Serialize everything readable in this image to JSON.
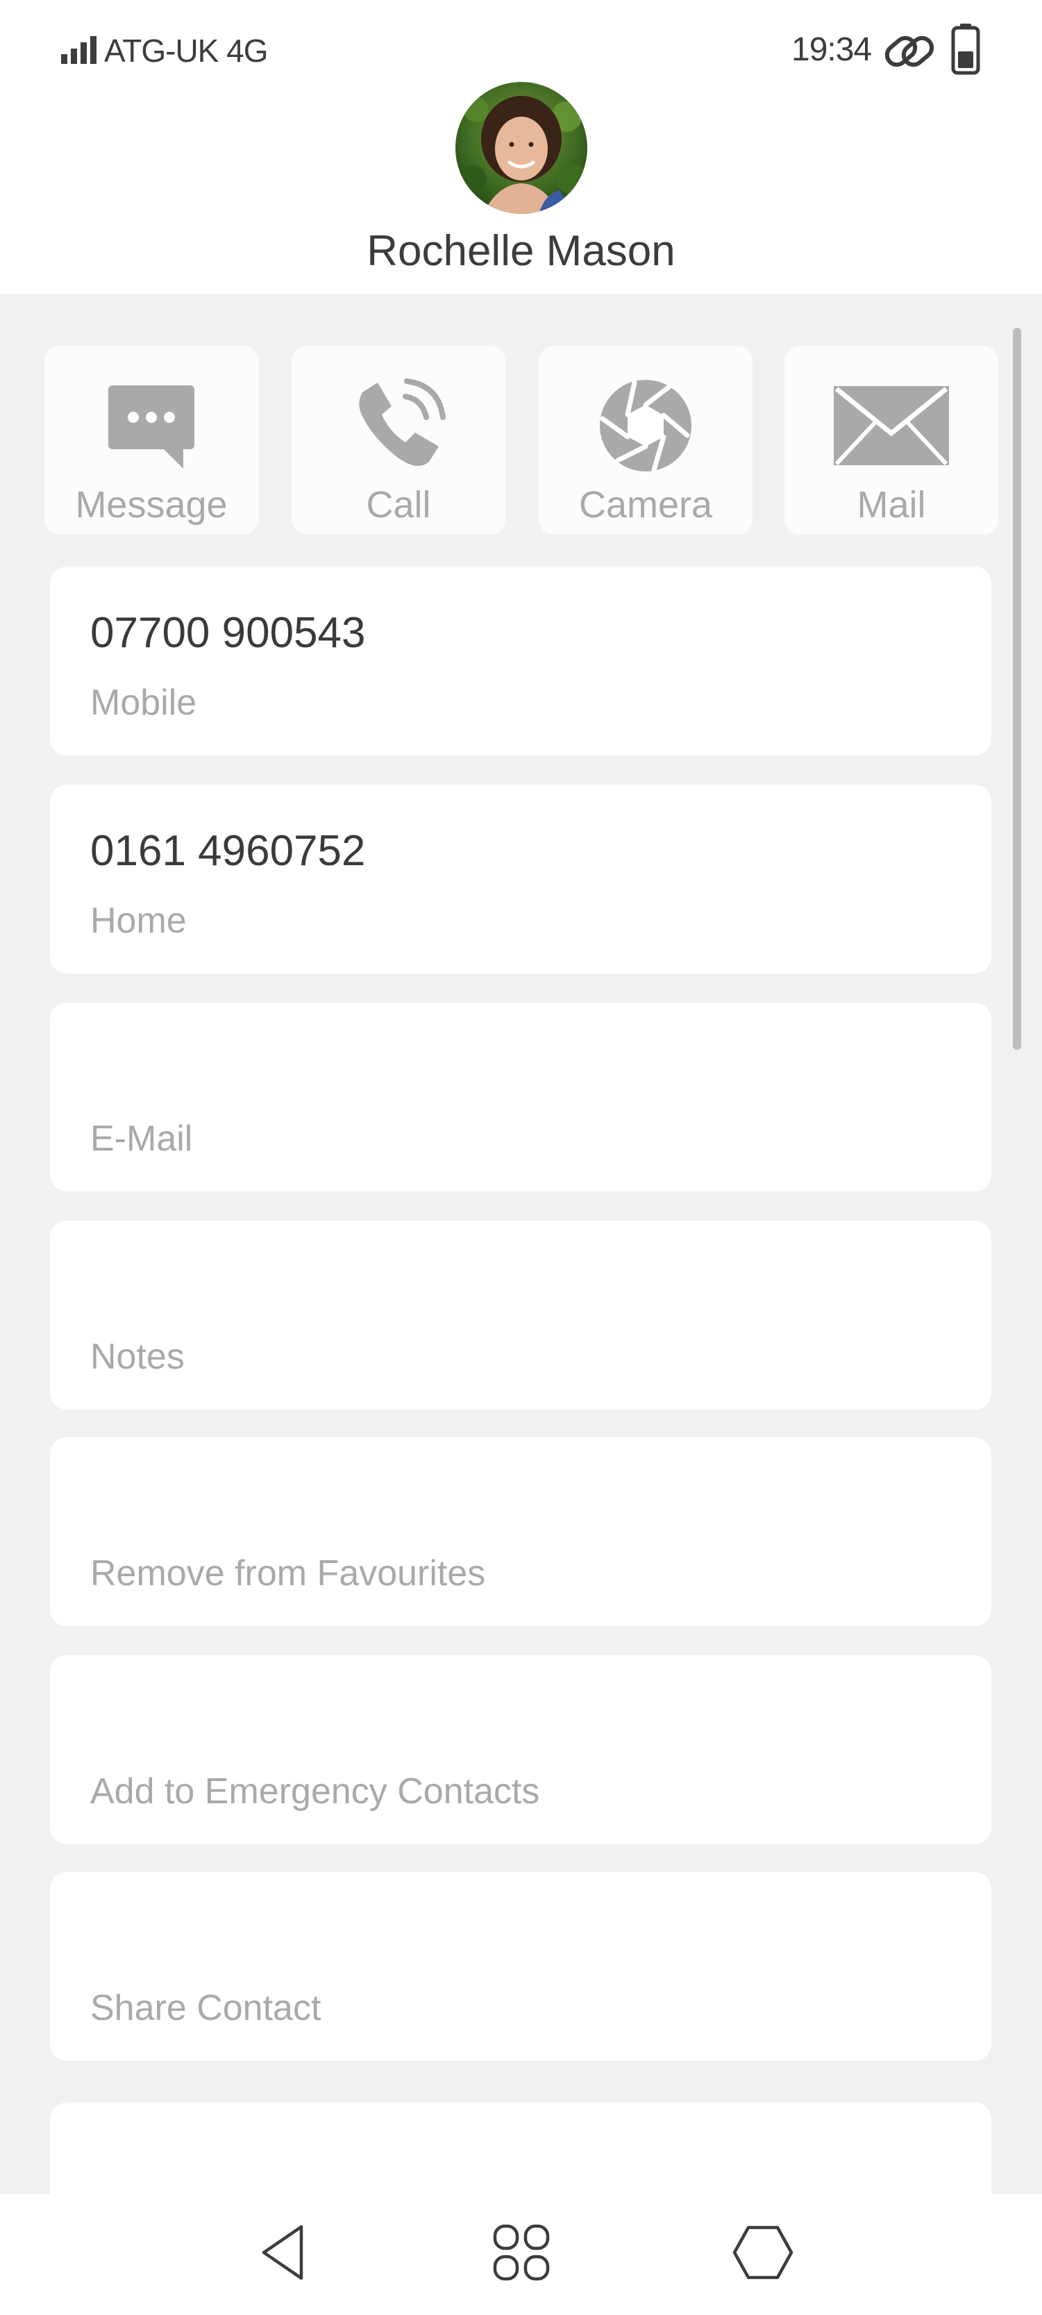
{
  "status_bar": {
    "carrier": "ATG-UK  4G",
    "time": "19:34",
    "icons": [
      "signal-icon",
      "link-icon",
      "battery-icon"
    ]
  },
  "contact": {
    "name": "Rochelle Mason",
    "avatar": "avatar-photo"
  },
  "actions": [
    {
      "label": "Message",
      "icon": "message-icon"
    },
    {
      "label": "Call",
      "icon": "phone-icon"
    },
    {
      "label": "Camera",
      "icon": "camera-aperture-icon"
    },
    {
      "label": "Mail",
      "icon": "mail-icon"
    }
  ],
  "fields": [
    {
      "value": "07700 900543",
      "caption": "Mobile"
    },
    {
      "value": "0161 4960752",
      "caption": "Home"
    },
    {
      "value": "",
      "caption": "E-Mail"
    },
    {
      "value": "",
      "caption": "Notes"
    },
    {
      "value": "",
      "caption": "Remove from Favourites"
    },
    {
      "value": "",
      "caption": "Add to Emergency Contacts"
    },
    {
      "value": "",
      "caption": "Share Contact"
    },
    {
      "value": "",
      "caption": ""
    }
  ],
  "navigation": [
    "back-icon",
    "home-apps-icon",
    "recents-icon"
  ],
  "colors": {
    "background": "#f1f1f1",
    "card": "#ffffff",
    "icon_grey": "#a9a9a9",
    "text_dark": "#3c3c3c"
  }
}
